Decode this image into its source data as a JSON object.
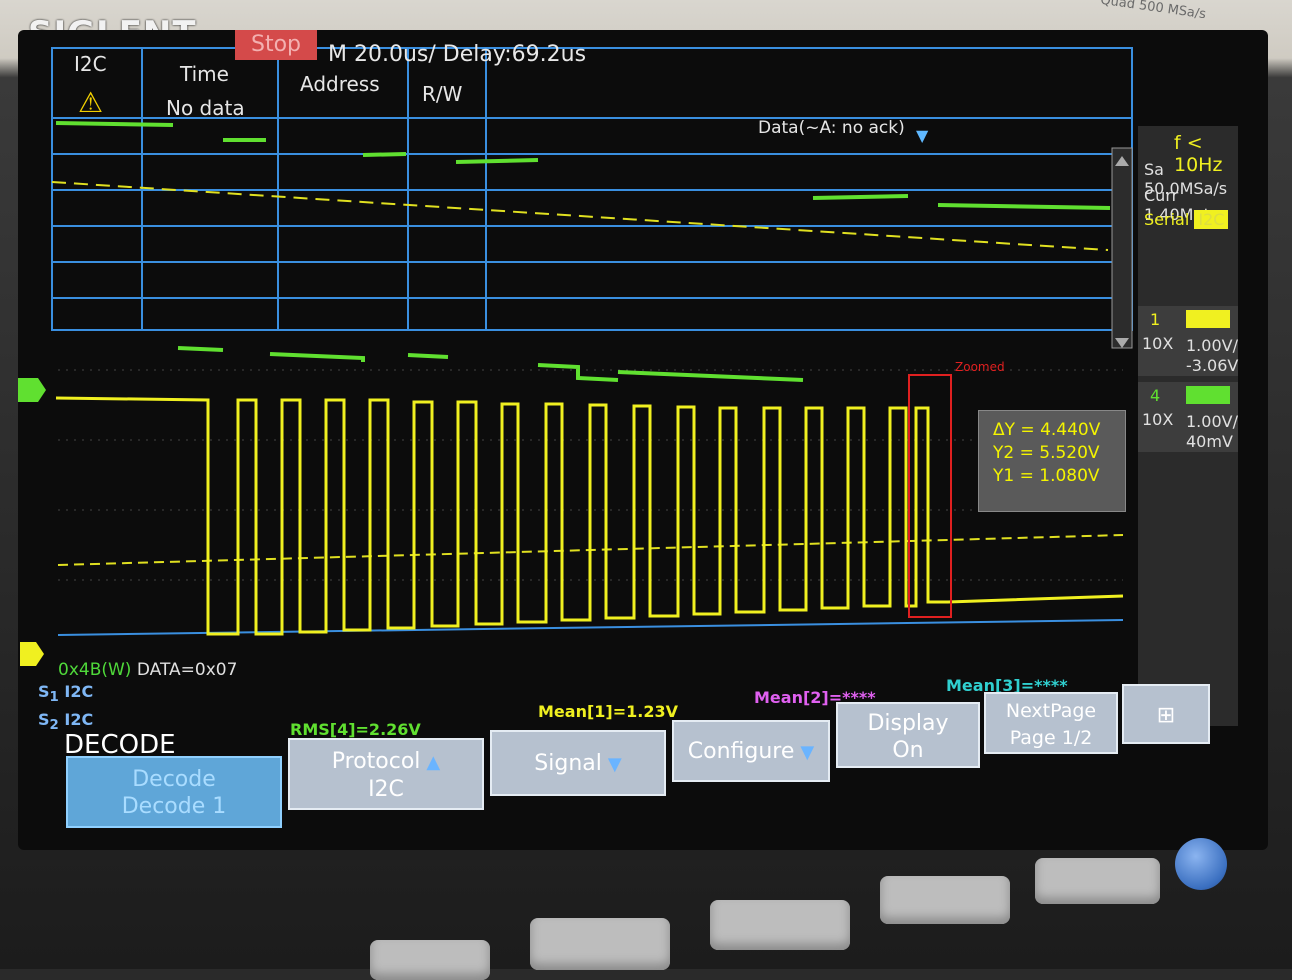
{
  "brand": "SIGLENT",
  "status": "Stop",
  "timebase": "M 20.0us/",
  "delay": "Delay:69.2us",
  "device_info": "Quad 500 MSa/s",
  "decode_table": {
    "columns": [
      "I2C",
      "Time",
      "Address",
      "R/W"
    ],
    "no_data": "No data",
    "data_header": "Data(~A: no ack)"
  },
  "right_panel": {
    "freq": "f < 10Hz",
    "sample_rate": "Sa 50.0MSa/s",
    "memory": "Curr 1.40Mpts",
    "serial": "Serial",
    "serial_badge": "I2C",
    "ch1": {
      "num": "1",
      "probe": "10X",
      "scale": "1.00V/",
      "offset": "-3.06V"
    },
    "ch4": {
      "num": "4",
      "probe": "10X",
      "scale": "1.00V/",
      "offset": "40mV"
    }
  },
  "cursor": {
    "dy": "ΔY = 4.440V",
    "y2": "Y2 = 5.520V",
    "y1": "Y1 = 1.080V"
  },
  "zoom_label": "Zoomed",
  "bus": {
    "s1": "I2C",
    "s2": "I2C",
    "addr": "0x4B(W)",
    "data": "DATA=0x07"
  },
  "measurements": {
    "rms4": "RMS[4]=2.26V",
    "mean1": "Mean[1]=1.23V",
    "mean2": "Mean[2]=****",
    "mean3": "Mean[3]=****"
  },
  "menu": {
    "title": "DECODE",
    "decode": {
      "line1": "Decode",
      "line2": "Decode 1"
    },
    "protocol": {
      "line1": "Protocol",
      "line2": "I2C"
    },
    "signal": "Signal",
    "configure": "Configure",
    "display": {
      "line1": "Display",
      "line2": "On"
    },
    "nextpage": {
      "line1": "NextPage",
      "line2": "Page 1/2"
    }
  },
  "colors": {
    "ch1": "#f0f020",
    "ch4": "#60e030",
    "grid": "#3a8fe0",
    "accent": "#5fa6d8"
  },
  "icons": [
    "warning-icon",
    "network-icon",
    "arrow-up-icon",
    "arrow-down-icon"
  ]
}
